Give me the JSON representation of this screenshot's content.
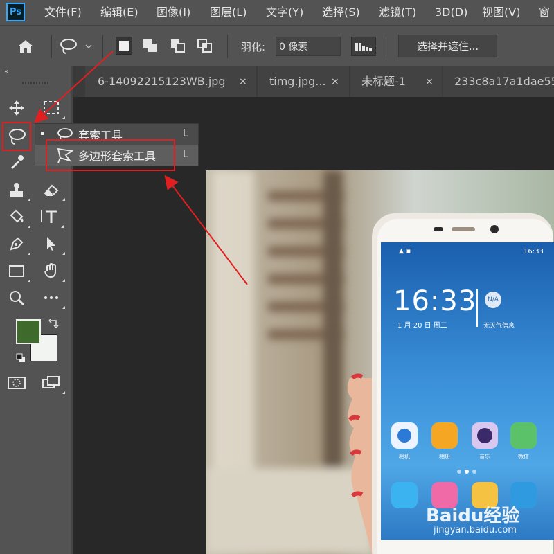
{
  "app": {
    "logo": "Ps"
  },
  "menubar": {
    "items": [
      "文件(F)",
      "编辑(E)",
      "图像(I)",
      "图层(L)",
      "文字(Y)",
      "选择(S)",
      "滤镜(T)",
      "3D(D)",
      "视图(V)",
      "窗"
    ]
  },
  "options_bar": {
    "feather_label": "羽化:",
    "feather_value": "0 像素",
    "select_mask_label": "选择并遮住..."
  },
  "tabs": [
    {
      "label": "6-14092215123WB.jpg",
      "close": "×"
    },
    {
      "label": "timg.jpg...",
      "close": "×"
    },
    {
      "label": "未标题-1",
      "close": "×"
    },
    {
      "label": "233c8a17a1dae55",
      "close": ""
    }
  ],
  "flyout": {
    "items": [
      {
        "label": "套索工具",
        "shortcut": "L"
      },
      {
        "label": "多边形套索工具",
        "shortcut": "L"
      }
    ]
  },
  "colors": {
    "foreground": "#3e6b2c",
    "background": "#f2f4f1",
    "highlight": "#e02020"
  },
  "phone_screen": {
    "time": "16:33",
    "status_time": "16:33",
    "date": "1 月 20 日 周二",
    "weather": "无天气信息",
    "weather_badge": "N/A",
    "apps_row1": [
      "相机",
      "相册",
      "音乐",
      "微信"
    ]
  },
  "watermark": {
    "brand": "Baidu经验",
    "url": "jingyan.baidu.com"
  }
}
